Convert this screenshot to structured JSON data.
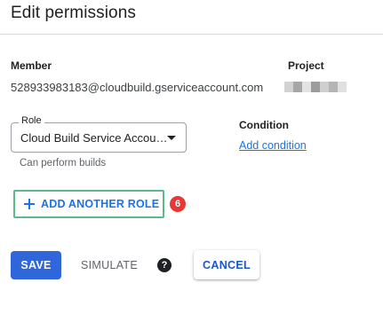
{
  "dialog": {
    "title": "Edit permissions"
  },
  "member": {
    "label": "Member",
    "value": "528933983183@cloudbuild.gserviceaccount.com"
  },
  "project": {
    "label": "Project",
    "blur_colors": [
      "#d2d2d2",
      "#a6a6a6",
      "#e3e3e3",
      "#9c9c9c",
      "#cfcfcf",
      "#b4b4b4",
      "#e0e0e0"
    ]
  },
  "role": {
    "label": "Role",
    "selected": "Cloud Build Service Accou…",
    "helper": "Can perform builds",
    "dropdown_icon": "arrow-drop-down-icon"
  },
  "condition": {
    "label": "Condition",
    "add_link": "Add condition"
  },
  "add_role": {
    "label": "ADD ANOTHER ROLE",
    "icon": "plus-icon",
    "highlight_color": "#5bb98a"
  },
  "step_badge": {
    "number": "6",
    "color": "#e53935"
  },
  "actions": {
    "save": "SAVE",
    "simulate": "SIMULATE",
    "help": "?",
    "cancel": "CANCEL"
  },
  "colors": {
    "accent": "#1a73e8",
    "primary_button": "#2f66db"
  }
}
